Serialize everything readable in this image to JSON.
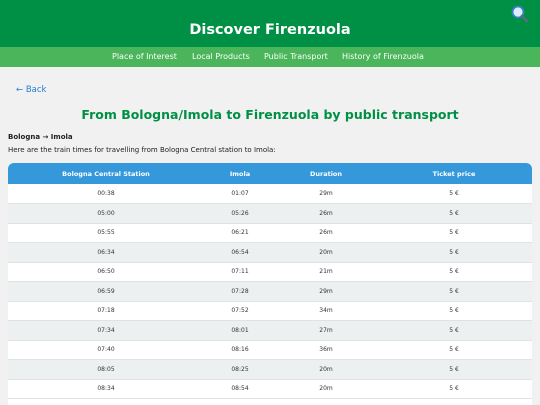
{
  "header": {
    "title": "Discover Firenzuola",
    "search_icon": "search-icon"
  },
  "nav": {
    "items": [
      "Place of Interest",
      "Local Products",
      "Public Transport",
      "History of Firenzuola"
    ]
  },
  "back_label": "← Back",
  "page_title": "From Bologna/Imola to Firenzuola by public transport",
  "route": {
    "title": "Bologna → Imola",
    "description": "Here are the train times for travelling from Bologna Central station to Imola:"
  },
  "table": {
    "headers": [
      "Bologna Central Station",
      "Imola",
      "Duration",
      "Ticket price"
    ],
    "rows": [
      [
        "00:38",
        "01:07",
        "29m",
        "5 €"
      ],
      [
        "05:00",
        "05:26",
        "26m",
        "5 €"
      ],
      [
        "05:55",
        "06:21",
        "26m",
        "5 €"
      ],
      [
        "06:34",
        "06:54",
        "20m",
        "5 €"
      ],
      [
        "06:50",
        "07:11",
        "21m",
        "5 €"
      ],
      [
        "06:59",
        "07:28",
        "29m",
        "5 €"
      ],
      [
        "07:18",
        "07:52",
        "34m",
        "5 €"
      ],
      [
        "07:34",
        "08:01",
        "27m",
        "5 €"
      ],
      [
        "07:40",
        "08:16",
        "36m",
        "5 €"
      ],
      [
        "08:05",
        "08:25",
        "20m",
        "5 €"
      ],
      [
        "08:34",
        "08:54",
        "20m",
        "5 €"
      ]
    ]
  },
  "colors": {
    "header_green": "#009045",
    "nav_green": "#4ab55a",
    "table_header_blue": "#3498db",
    "link_blue": "#2b7bd6"
  }
}
